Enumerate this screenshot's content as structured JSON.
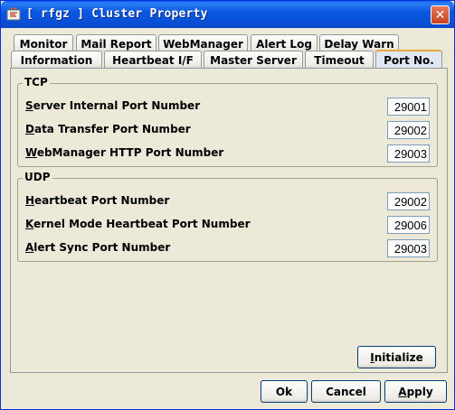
{
  "window": {
    "title": "[ rfgz ] Cluster Property",
    "close_glyph": "✕"
  },
  "tabs_row1": [
    {
      "label": "Monitor"
    },
    {
      "label": "Mail Report"
    },
    {
      "label": "WebManager"
    },
    {
      "label": "Alert Log"
    },
    {
      "label": "Delay Warn"
    }
  ],
  "tabs_row2": [
    {
      "label": "Information"
    },
    {
      "label": "Heartbeat I/F"
    },
    {
      "label": "Master Server"
    },
    {
      "label": "Timeout"
    },
    {
      "label": "Port No.",
      "selected": true
    }
  ],
  "tcp": {
    "title": "TCP",
    "rows": [
      {
        "mnemonic": "S",
        "rest": "erver Internal Port Number",
        "value": "29001"
      },
      {
        "mnemonic": "D",
        "rest": "ata Transfer Port Number",
        "value": "29002"
      },
      {
        "mnemonic": "W",
        "rest": "ebManager HTTP Port Number",
        "value": "29003"
      }
    ]
  },
  "udp": {
    "title": "UDP",
    "rows": [
      {
        "mnemonic": "H",
        "rest": "eartbeat Port Number",
        "value": "29002"
      },
      {
        "mnemonic": "K",
        "rest": "ernel Mode Heartbeat Port Number",
        "value": "29006"
      },
      {
        "mnemonic": "A",
        "rest": "lert Sync Port Number",
        "value": "29003"
      }
    ]
  },
  "buttons": {
    "initialize": {
      "mnemonic": "I",
      "rest": "nitialize"
    },
    "ok": "Ok",
    "cancel": "Cancel",
    "apply": {
      "mnemonic": "A",
      "rest": "pply"
    }
  }
}
